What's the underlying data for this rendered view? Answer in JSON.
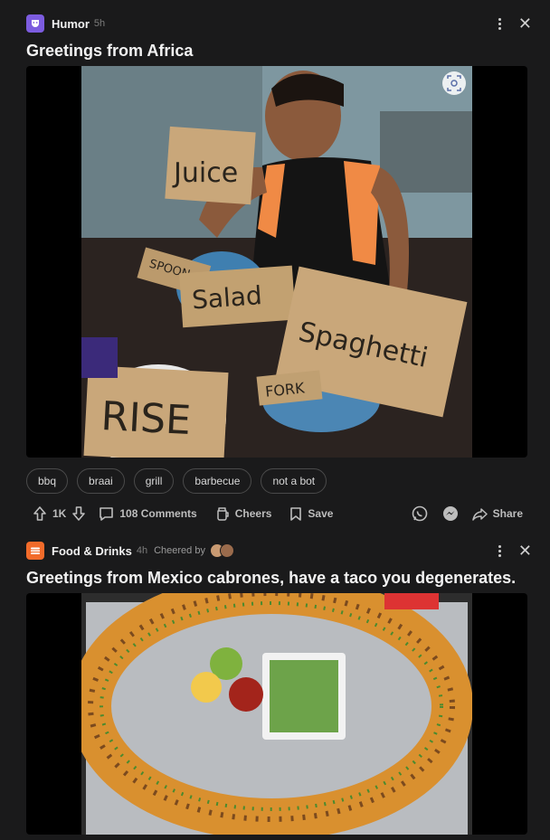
{
  "post1": {
    "category": "Humor",
    "age": "5h",
    "title": "Greetings from Africa",
    "image_signs": [
      "Juice",
      "Spoon",
      "Salad",
      "Spaghetti",
      "Fork",
      "Rise"
    ],
    "tags": [
      "bbq",
      "braai",
      "grill",
      "barbecue",
      "not a bot"
    ],
    "vote_count": "1K",
    "comments_label": "108 Comments",
    "cheers_label": "Cheers",
    "save_label": "Save",
    "share_label": "Share",
    "colors": {
      "category_icon": "#7c5cdf"
    }
  },
  "post2": {
    "category": "Food & Drinks",
    "age": "4h",
    "cheered_by": "Cheered by",
    "title": "Greetings from Mexico cabrones, have a taco you degenerates.",
    "colors": {
      "category_icon": "#f26b2a"
    }
  }
}
